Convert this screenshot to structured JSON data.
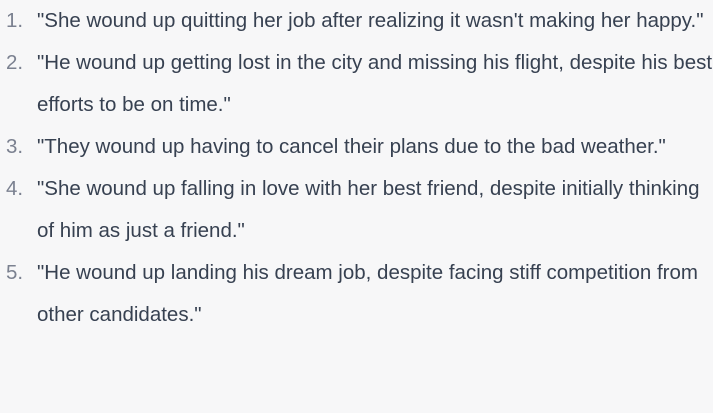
{
  "items": [
    {
      "number": "1.",
      "text": "\"She wound up quitting her job after realizing it wasn't making her happy.\""
    },
    {
      "number": "2.",
      "text": "\"He wound up getting lost in the city and missing his flight, despite his best efforts to be on time.\""
    },
    {
      "number": "3.",
      "text": "\"They wound up having to cancel their plans due to the bad weather.\""
    },
    {
      "number": "4.",
      "text": "\"She wound up falling in love with her best friend, despite initially thinking of him as just a friend.\""
    },
    {
      "number": "5.",
      "text": "\"He wound up landing his dream job, despite facing stiff competition from other candidates.\""
    }
  ]
}
